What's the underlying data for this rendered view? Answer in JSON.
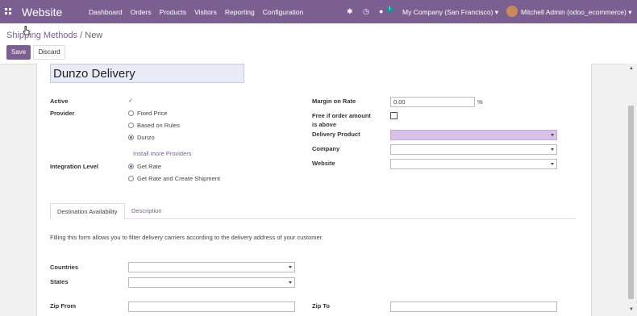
{
  "topbar": {
    "brand": "Website",
    "menu": [
      "Dashboard",
      "Orders",
      "Products",
      "Visitors",
      "Reporting",
      "Configuration"
    ],
    "chat_badge": "1",
    "company": "My Company (San Francisco)",
    "user": "Mitchell Admin (odoo_ecommerce)"
  },
  "breadcrumb": {
    "parent": "Shipping Methods",
    "separator": "/",
    "current": "New"
  },
  "buttons": {
    "save": "Save",
    "discard": "Discard"
  },
  "form": {
    "name": "Dunzo Delivery",
    "active_label": "Active",
    "active_checked": true,
    "provider_label": "Provider",
    "providers": [
      {
        "label": "Fixed Price",
        "selected": false
      },
      {
        "label": "Based on Rules",
        "selected": false
      },
      {
        "label": "Dunzo",
        "selected": true
      }
    ],
    "install_link": "Install more Providers",
    "integration_label": "Integration Level",
    "integration": [
      {
        "label": "Get Rate",
        "selected": true
      },
      {
        "label": "Get Rate and Create Shipment",
        "selected": false
      }
    ],
    "margin_label": "Margin on Rate",
    "margin_value": "0.00",
    "margin_unit": "%",
    "free_label_1": "Free if order amount",
    "free_label_2": "is above",
    "delivery_product_label": "Delivery Product",
    "delivery_product_value": "",
    "company_label": "Company",
    "company_value": "",
    "website_label": "Website",
    "website_value": ""
  },
  "tabs": [
    {
      "label": "Destination Availability",
      "active": true
    },
    {
      "label": "Description",
      "active": false
    }
  ],
  "destination": {
    "help": "Filling this form allows you to filter delivery carriers according to the delivery address of your customer.",
    "countries_label": "Countries",
    "states_label": "States",
    "zip_from_label": "Zip From",
    "zip_to_label": "Zip To"
  },
  "colors": {
    "brand": "#7c5f91",
    "required_field": "#d8c3e8",
    "badge": "#00a09d"
  }
}
